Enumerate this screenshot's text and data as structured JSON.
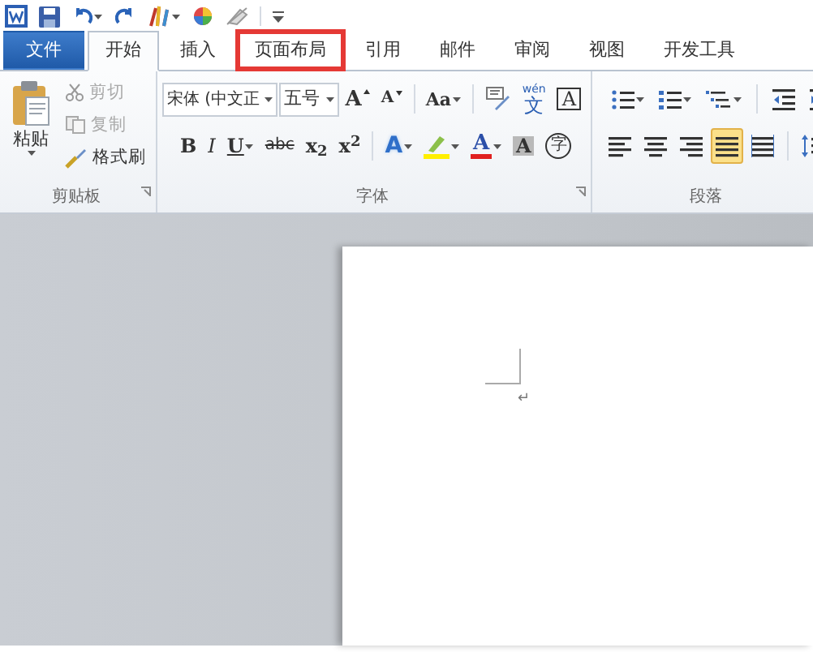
{
  "tabs": [
    {
      "label": "文件",
      "kind": "file",
      "selected": false,
      "highlighted": false
    },
    {
      "label": "开始",
      "kind": "tab",
      "selected": true,
      "highlighted": false
    },
    {
      "label": "插入",
      "kind": "tab",
      "selected": false,
      "highlighted": false
    },
    {
      "label": "页面布局",
      "kind": "tab",
      "selected": false,
      "highlighted": true
    },
    {
      "label": "引用",
      "kind": "tab",
      "selected": false,
      "highlighted": false
    },
    {
      "label": "邮件",
      "kind": "tab",
      "selected": false,
      "highlighted": false
    },
    {
      "label": "审阅",
      "kind": "tab",
      "selected": false,
      "highlighted": false
    },
    {
      "label": "视图",
      "kind": "tab",
      "selected": false,
      "highlighted": false
    },
    {
      "label": "开发工具",
      "kind": "tab",
      "selected": false,
      "highlighted": false
    }
  ],
  "clipboard": {
    "paste": "粘贴",
    "group_label": "剪贴板",
    "items": [
      {
        "label": "剪切",
        "kind": "cut",
        "disabled": true
      },
      {
        "label": "复制",
        "kind": "copy",
        "disabled": true
      },
      {
        "label": "格式刷",
        "kind": "painter",
        "disabled": false
      }
    ]
  },
  "font": {
    "font_name": "宋体 (中文正",
    "font_size": "五号",
    "group_label": "字体",
    "row_1": [
      {
        "kind": "grow",
        "label": "A"
      },
      {
        "kind": "shrink",
        "label": "A"
      },
      {
        "kind": "case",
        "label": "Aa"
      },
      {
        "kind": "pinyin"
      },
      {
        "kind": "phonetic",
        "label": "文",
        "ruby": "wén"
      },
      {
        "kind": "border",
        "label": "A"
      }
    ],
    "row_2": [
      {
        "kind": "bold",
        "label": "B"
      },
      {
        "kind": "italic",
        "label": "I"
      },
      {
        "kind": "underline",
        "label": "U"
      },
      {
        "kind": "strike",
        "label": "abc"
      },
      {
        "kind": "script",
        "label": "x$_{2}$"
      },
      {
        "kind": "script",
        "label": "x$^{2}$"
      },
      {
        "kind": "effect",
        "label": "A"
      },
      {
        "kind": "highlight"
      },
      {
        "kind": "color",
        "label": "A"
      },
      {
        "kind": "shade",
        "label": "A"
      },
      {
        "kind": "enclose",
        "label": "字"
      }
    ]
  },
  "paragraph": {
    "group_label": "段落",
    "row_1": [
      {
        "kind": "bullets"
      },
      {
        "kind": "numbering"
      },
      {
        "kind": "multilevel"
      },
      {
        "kind": "outdent"
      },
      {
        "kind": "indent"
      }
    ],
    "align": [
      {
        "kind": "left",
        "selected": false
      },
      {
        "kind": "center",
        "selected": false
      },
      {
        "kind": "right",
        "selected": false
      },
      {
        "kind": "justify",
        "selected": true
      },
      {
        "kind": "distributed",
        "selected": false
      }
    ]
  },
  "document": {
    "paragraph_mark": "↵"
  }
}
